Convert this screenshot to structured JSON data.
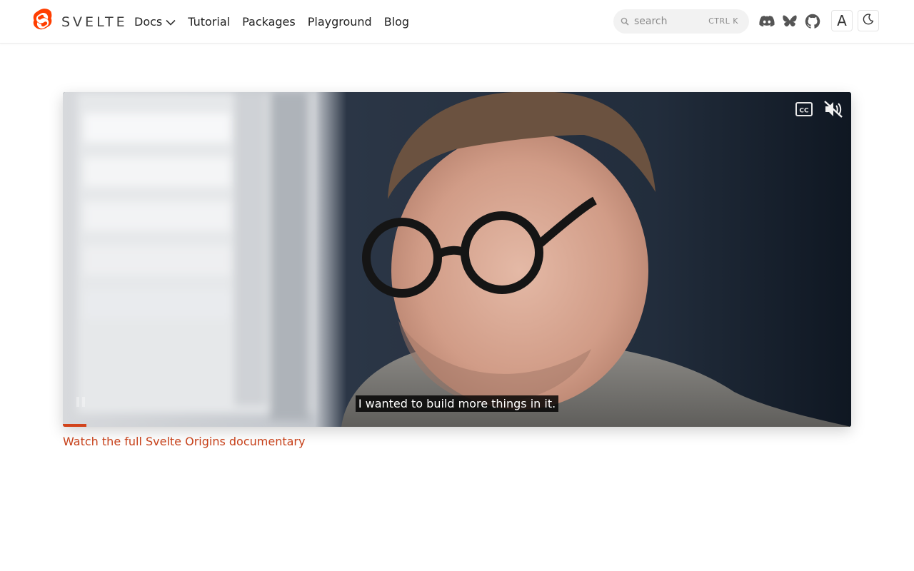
{
  "brand": {
    "name": "SVELTE",
    "accent": "#ff3e00"
  },
  "nav": {
    "links": [
      {
        "label": "Docs",
        "has_dropdown": true
      },
      {
        "label": "Tutorial"
      },
      {
        "label": "Packages"
      },
      {
        "label": "Playground"
      },
      {
        "label": "Blog"
      }
    ],
    "search": {
      "placeholder": "search",
      "shortcut": "CTRL K"
    },
    "social_icons": [
      "discord-icon",
      "bluesky-icon",
      "github-icon"
    ],
    "font_toggle_label": "A",
    "theme_icon": "moon-icon"
  },
  "video": {
    "caption": "I wanted to build more things in it.",
    "captions_icon": "cc-icon",
    "mute_icon": "muted-speaker-icon",
    "progress_fraction": 0.03,
    "progress_color": "#d2441c"
  },
  "documentary_link": {
    "label": "Watch the full Svelte Origins documentary",
    "color": "#c7411a"
  }
}
